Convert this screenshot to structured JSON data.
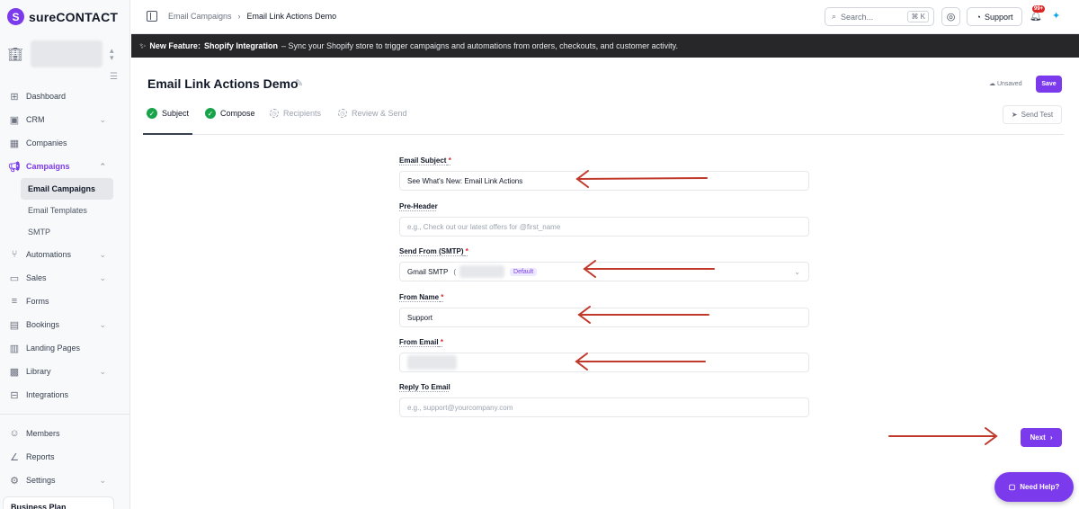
{
  "brand": {
    "name": "sureCONTACT",
    "accent": "#7c3aed"
  },
  "sidebar": {
    "items": [
      {
        "label": "Dashboard",
        "icon": "grid-icon",
        "chevron": false
      },
      {
        "label": "CRM",
        "icon": "contact-card-icon",
        "chevron": true
      },
      {
        "label": "Companies",
        "icon": "building-icon",
        "chevron": false
      },
      {
        "label": "Campaigns",
        "icon": "megaphone-icon",
        "chevron": true,
        "active": true
      }
    ],
    "campaign_subitems": [
      {
        "label": "Email Campaigns",
        "active": true
      },
      {
        "label": "Email Templates"
      },
      {
        "label": "SMTP"
      }
    ],
    "more_items": [
      {
        "label": "Automations",
        "icon": "flow-icon",
        "chevron": true
      },
      {
        "label": "Sales",
        "icon": "cart-icon",
        "chevron": true
      },
      {
        "label": "Forms",
        "icon": "form-icon",
        "chevron": false
      },
      {
        "label": "Bookings",
        "icon": "calendar-icon",
        "chevron": true
      },
      {
        "label": "Landing Pages",
        "icon": "layout-icon",
        "chevron": false
      },
      {
        "label": "Library",
        "icon": "library-icon",
        "chevron": true
      },
      {
        "label": "Integrations",
        "icon": "puzzle-icon",
        "chevron": false
      }
    ],
    "bottom_items": [
      {
        "label": "Members",
        "icon": "users-icon",
        "chevron": false
      },
      {
        "label": "Reports",
        "icon": "chart-icon",
        "chevron": false
      },
      {
        "label": "Settings",
        "icon": "gear-icon",
        "chevron": true
      }
    ],
    "plan_label": "Business Plan"
  },
  "topbar": {
    "breadcrumb": [
      "Email Campaigns",
      "Email Link Actions Demo"
    ],
    "search_placeholder": "Search...",
    "search_shortcut": "⌘ K",
    "support_label": "Support",
    "notification_count": "99+"
  },
  "banner": {
    "prefix": "New Feature:",
    "feature": "Shopify Integration",
    "text": "– Sync your Shopify store to trigger campaigns and automations from orders, checkouts, and customer activity."
  },
  "page": {
    "title": "Email Link Actions Demo",
    "status": "Unsaved",
    "save_label": "Save",
    "send_test_label": "Send Test",
    "steps": [
      {
        "label": "Subject",
        "done": true
      },
      {
        "label": "Compose",
        "done": true
      },
      {
        "label": "Recipients",
        "done": false
      },
      {
        "label": "Review & Send",
        "done": false
      }
    ]
  },
  "form": {
    "subject": {
      "label": "Email Subject",
      "required": "*",
      "value": "See What's New: Email Link Actions"
    },
    "preheader": {
      "label": "Pre-Header",
      "placeholder": "e.g., Check out our latest offers for @first_name"
    },
    "send_from": {
      "label": "Send From (SMTP)",
      "required": "*",
      "value": "Gmail SMTP",
      "paren": "(",
      "chip": "Default"
    },
    "from_name": {
      "label": "From Name",
      "required": "*",
      "value": "Support"
    },
    "from_email": {
      "label": "From Email",
      "required": "*"
    },
    "reply_to": {
      "label": "Reply To Email",
      "placeholder": "e.g., support@yourcompany.com"
    },
    "next_label": "Next"
  },
  "help": {
    "label": "Need Help?"
  },
  "annotation_color": "#c0392b"
}
